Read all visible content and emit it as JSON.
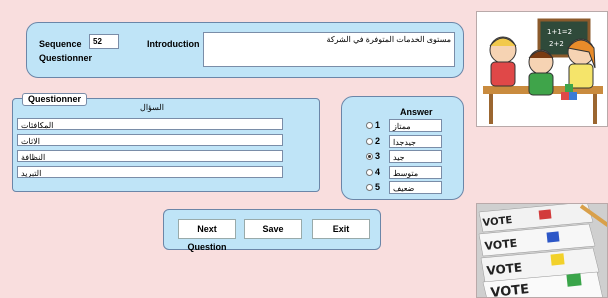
{
  "top": {
    "sequence_label": "Sequence",
    "sequence_value": "52",
    "questionner_label": "Questionner",
    "introduction_label": "Introduction",
    "introduction_value": "مستوى الخدمات المتوفرة في الشركة"
  },
  "questions": {
    "title": "Questionner",
    "header": "السؤال",
    "rows": [
      "المكافئات",
      "الاثاث",
      "النظافة",
      "التبريد"
    ]
  },
  "answers": {
    "title": "Answer",
    "options": [
      {
        "num": "1",
        "label": "ممتاز",
        "selected": false
      },
      {
        "num": "2",
        "label": "جيدجدا",
        "selected": false
      },
      {
        "num": "3",
        "label": "جيد",
        "selected": true
      },
      {
        "num": "4",
        "label": "متوسط",
        "selected": false
      },
      {
        "num": "5",
        "label": "ضعيف",
        "selected": false
      }
    ]
  },
  "buttons": {
    "next": "Next Question",
    "save": "Save",
    "exit": "Exit"
  },
  "images": {
    "top": "kids-classroom-clipart",
    "bottom": "vote-ballot-photo",
    "vote_words": [
      "VOTE",
      "VOTE",
      "VOTE",
      "VOTE"
    ]
  }
}
